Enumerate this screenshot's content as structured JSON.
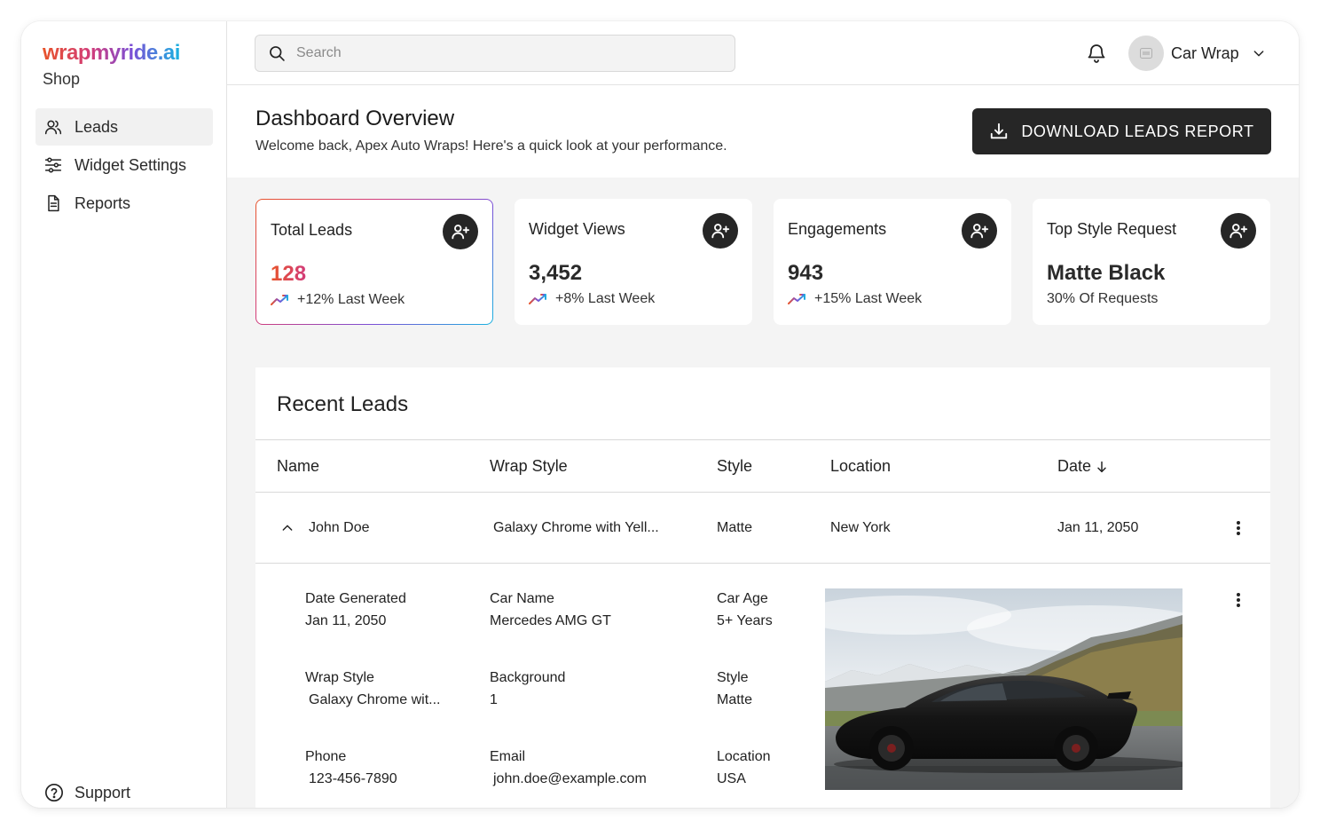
{
  "brand": {
    "logo": "wrapmyride.ai",
    "sub": "Shop"
  },
  "sidebar": {
    "items": [
      {
        "label": "Leads",
        "icon": "users-icon",
        "active": true
      },
      {
        "label": "Widget Settings",
        "icon": "sliders-icon",
        "active": false
      },
      {
        "label": "Reports",
        "icon": "document-icon",
        "active": false
      }
    ],
    "support": "Support"
  },
  "topbar": {
    "search_placeholder": "Search",
    "account_name": "Car Wrap"
  },
  "header": {
    "title": "Dashboard Overview",
    "subtitle": "Welcome back, Apex Auto Wraps! Here's a quick look at your performance.",
    "download_label": "DOWNLOAD LEADS REPORT"
  },
  "stats": [
    {
      "title": "Total Leads",
      "value": "128",
      "trend": "+12% Last Week"
    },
    {
      "title": "Widget Views",
      "value": "3,452",
      "trend": "+8% Last Week"
    },
    {
      "title": "Engagements",
      "value": "943",
      "trend": "+15% Last Week"
    },
    {
      "title": "Top Style Request",
      "value": "Matte Black",
      "trend": "30% Of Requests"
    }
  ],
  "leads": {
    "title": "Recent Leads",
    "columns": [
      "Name",
      "Wrap Style",
      "Style",
      "Location",
      "Date"
    ],
    "rows": [
      {
        "name": "John Doe",
        "wrap_style": "Galaxy Chrome with Yell...",
        "style": "Matte",
        "location": "New York",
        "date": "Jan 11, 2050"
      }
    ],
    "detail": {
      "date_generated_label": "Date Generated",
      "date_generated": "Jan 11, 2050",
      "car_name_label": "Car Name",
      "car_name": "Mercedes AMG GT",
      "car_age_label": "Car Age",
      "car_age": "5+ Years",
      "wrap_style_label": "Wrap Style",
      "wrap_style": "Galaxy Chrome wit...",
      "background_label": "Background",
      "background": "1",
      "style_label": "Style",
      "style": "Matte",
      "phone_label": "Phone",
      "phone": "123-456-7890",
      "email_label": "Email",
      "email": "john.doe@example.com",
      "location_label": "Location",
      "location": "USA"
    }
  },
  "colors": {
    "dark": "#262626",
    "panel_bg": "#f4f4f4",
    "accent_start": "#e8542a",
    "accent_end": "#19b2e0"
  }
}
